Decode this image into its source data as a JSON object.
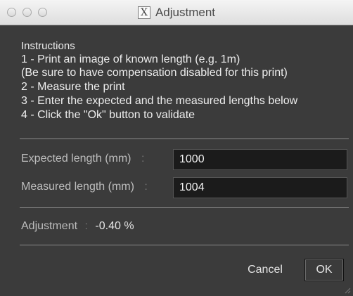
{
  "window": {
    "title": "Adjustment",
    "icon": "x-window-icon",
    "icon_glyph": "X"
  },
  "instructions": {
    "heading": "Instructions",
    "lines": [
      "1 - Print an image of known length (e.g. 1m)",
      "(Be sure to have compensation disabled for this print)",
      "2 - Measure the print",
      "3 - Enter the expected and the measured lengths below",
      "4 - Click the \"Ok\" button to validate"
    ]
  },
  "fields": {
    "separator": ":",
    "expected": {
      "label": "Expected length (mm)",
      "value": "1000"
    },
    "measured": {
      "label": "Measured length (mm)",
      "value": "1004"
    }
  },
  "result": {
    "label": "Adjustment",
    "separator": ":",
    "value": "-0.40 %"
  },
  "buttons": {
    "cancel": "Cancel",
    "ok": "OK"
  },
  "colors": {
    "background": "#3b3b3b",
    "input_background": "#1b1b1b",
    "text": "#ededed",
    "titlebar": "#e6e6e6"
  }
}
